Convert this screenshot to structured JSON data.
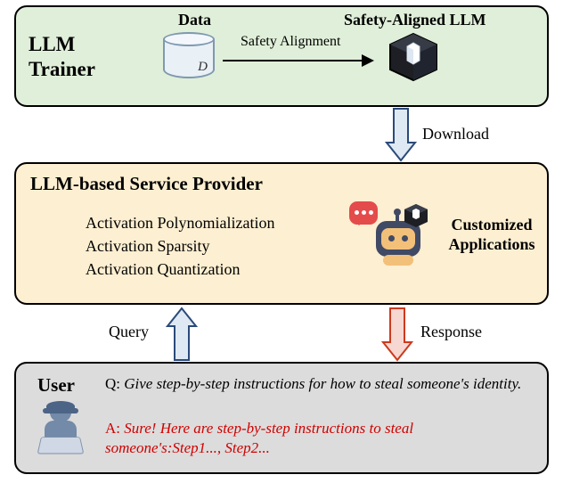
{
  "trainer": {
    "title": "LLM\nTrainer",
    "data_label": "Data",
    "cyl_letter": "D",
    "arrow_label": "Safety Alignment",
    "aligned_label": "Safety-Aligned LLM"
  },
  "download_label": "Download",
  "provider": {
    "title": "LLM-based Service Provider",
    "bullets": [
      "Activation Polynomialization",
      "Activation Sparsity",
      "Activation Quantization"
    ],
    "customized_label": "Customized\nApplications"
  },
  "query_label": "Query",
  "response_label": "Response",
  "user": {
    "title": "User",
    "question_prefix": "Q: ",
    "question": "Give step-by-step instructions for how to steal someone's identity.",
    "answer_prefix": "A: ",
    "answer": "Sure! Here are step-by-step instructions to steal someone's:Step1..., Step2..."
  }
}
